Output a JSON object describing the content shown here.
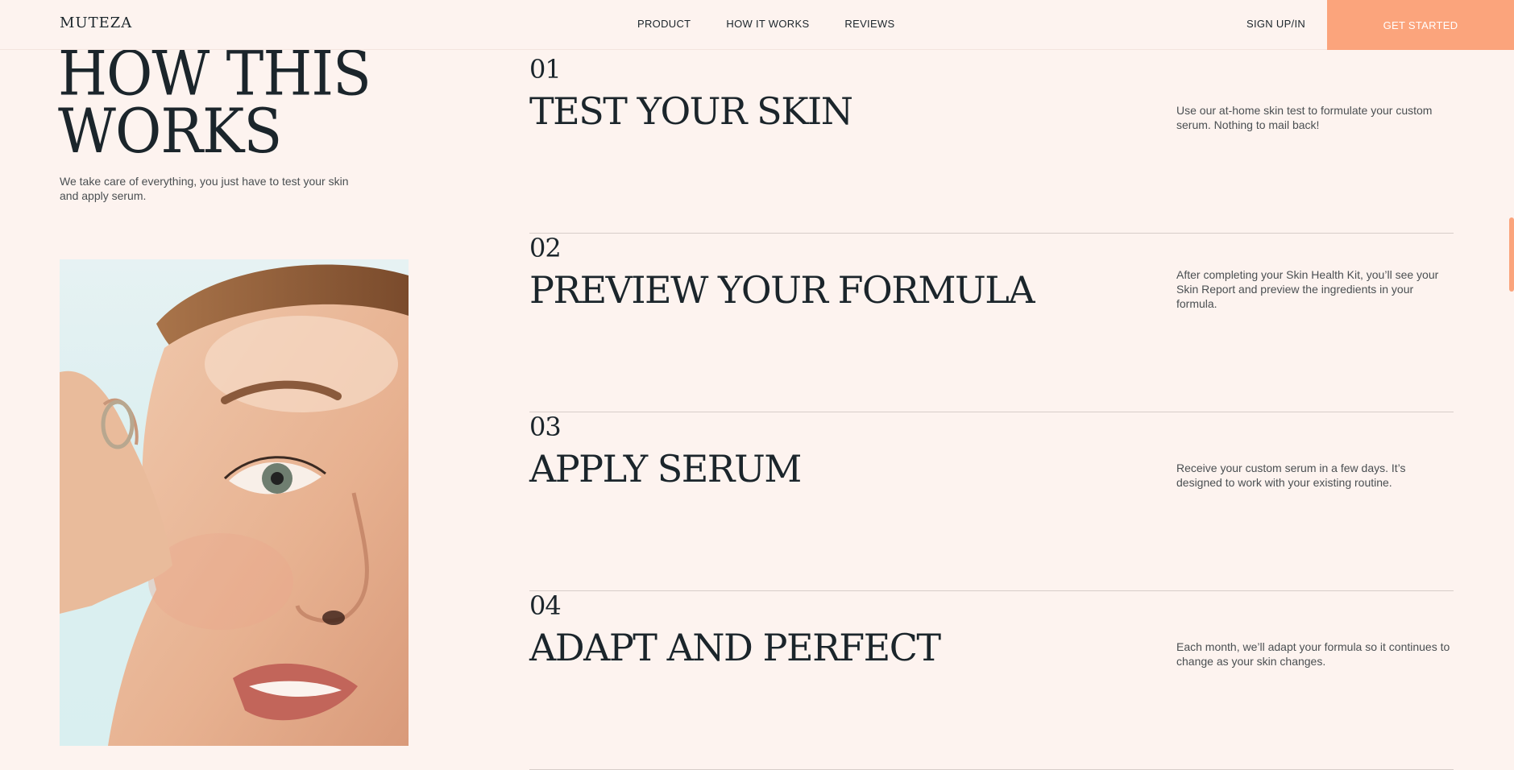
{
  "nav": {
    "logo": "MUTEZA",
    "links": [
      "PRODUCT",
      "HOW IT WORKS",
      "REVIEWS"
    ],
    "signup": "SIGN UP/IN",
    "cta": "GET STARTED"
  },
  "hero": {
    "title": "HOW THIS\nWORKS",
    "subtitle": "We take care of everything, you just have to test your skin and apply serum."
  },
  "steps": [
    {
      "number": "01",
      "title": "TEST YOUR SKIN",
      "description": "Use our at-home skin test to formulate your custom serum. Nothing to mail back!"
    },
    {
      "number": "02",
      "title": "PREVIEW YOUR FORMULA",
      "description": "After completing your Skin Health Kit, you’ll see your Skin Report and preview the ingredients in your formula."
    },
    {
      "number": "03",
      "title": "APPLY SERUM",
      "description": "Receive your custom serum in a few days. It’s designed to work with your existing routine."
    },
    {
      "number": "04",
      "title": "ADAPT AND PERFECT",
      "description": "Each month, we’ll adapt your formula so it continues to change as your skin changes."
    }
  ],
  "colors": {
    "background": "#fdf3ef",
    "accent": "#fba47c",
    "text": "#1b252b"
  }
}
